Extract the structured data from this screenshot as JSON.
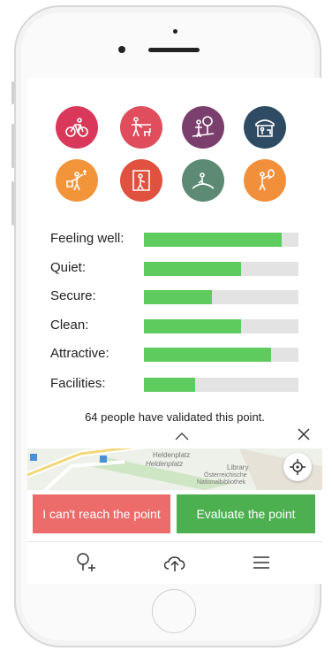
{
  "category_icons": [
    {
      "name": "cycling-icon",
      "color": "#d9385a"
    },
    {
      "name": "dog-walking-icon",
      "color": "#e04d5c"
    },
    {
      "name": "park-icon",
      "color": "#7b3f6e"
    },
    {
      "name": "market-stall-icon",
      "color": "#2f4b63"
    },
    {
      "name": "street-music-icon",
      "color": "#f2953a"
    },
    {
      "name": "door-access-icon",
      "color": "#e0523f"
    },
    {
      "name": "hill-rest-icon",
      "color": "#5c8a72"
    },
    {
      "name": "balloon-icon",
      "color": "#f28f3b"
    }
  ],
  "metrics": [
    {
      "label": "Feeling well:",
      "value": 0.89
    },
    {
      "label": "Quiet:",
      "value": 0.63
    },
    {
      "label": "Secure:",
      "value": 0.44
    },
    {
      "label": "Clean:",
      "value": 0.63
    },
    {
      "label": "Attractive:",
      "value": 0.82
    },
    {
      "label": "Facilities:",
      "value": 0.33
    }
  ],
  "validated_text": "64 people have validated this point.",
  "map": {
    "labels": [
      "Heldenplatz",
      "Heldenplatz",
      "Library",
      "Österreichische",
      "Nationalbibliothek"
    ]
  },
  "buttons": {
    "cant_reach": "I can't reach the point",
    "evaluate": "Evaluate the point"
  },
  "colors": {
    "bar_fill": "#5ecb5e",
    "bar_bg": "#e3e3e3",
    "button_red": "#ec6c6c",
    "button_green": "#4caf50"
  },
  "bottom_nav": [
    {
      "name": "add-location-icon"
    },
    {
      "name": "cloud-upload-icon"
    },
    {
      "name": "menu-icon"
    }
  ]
}
